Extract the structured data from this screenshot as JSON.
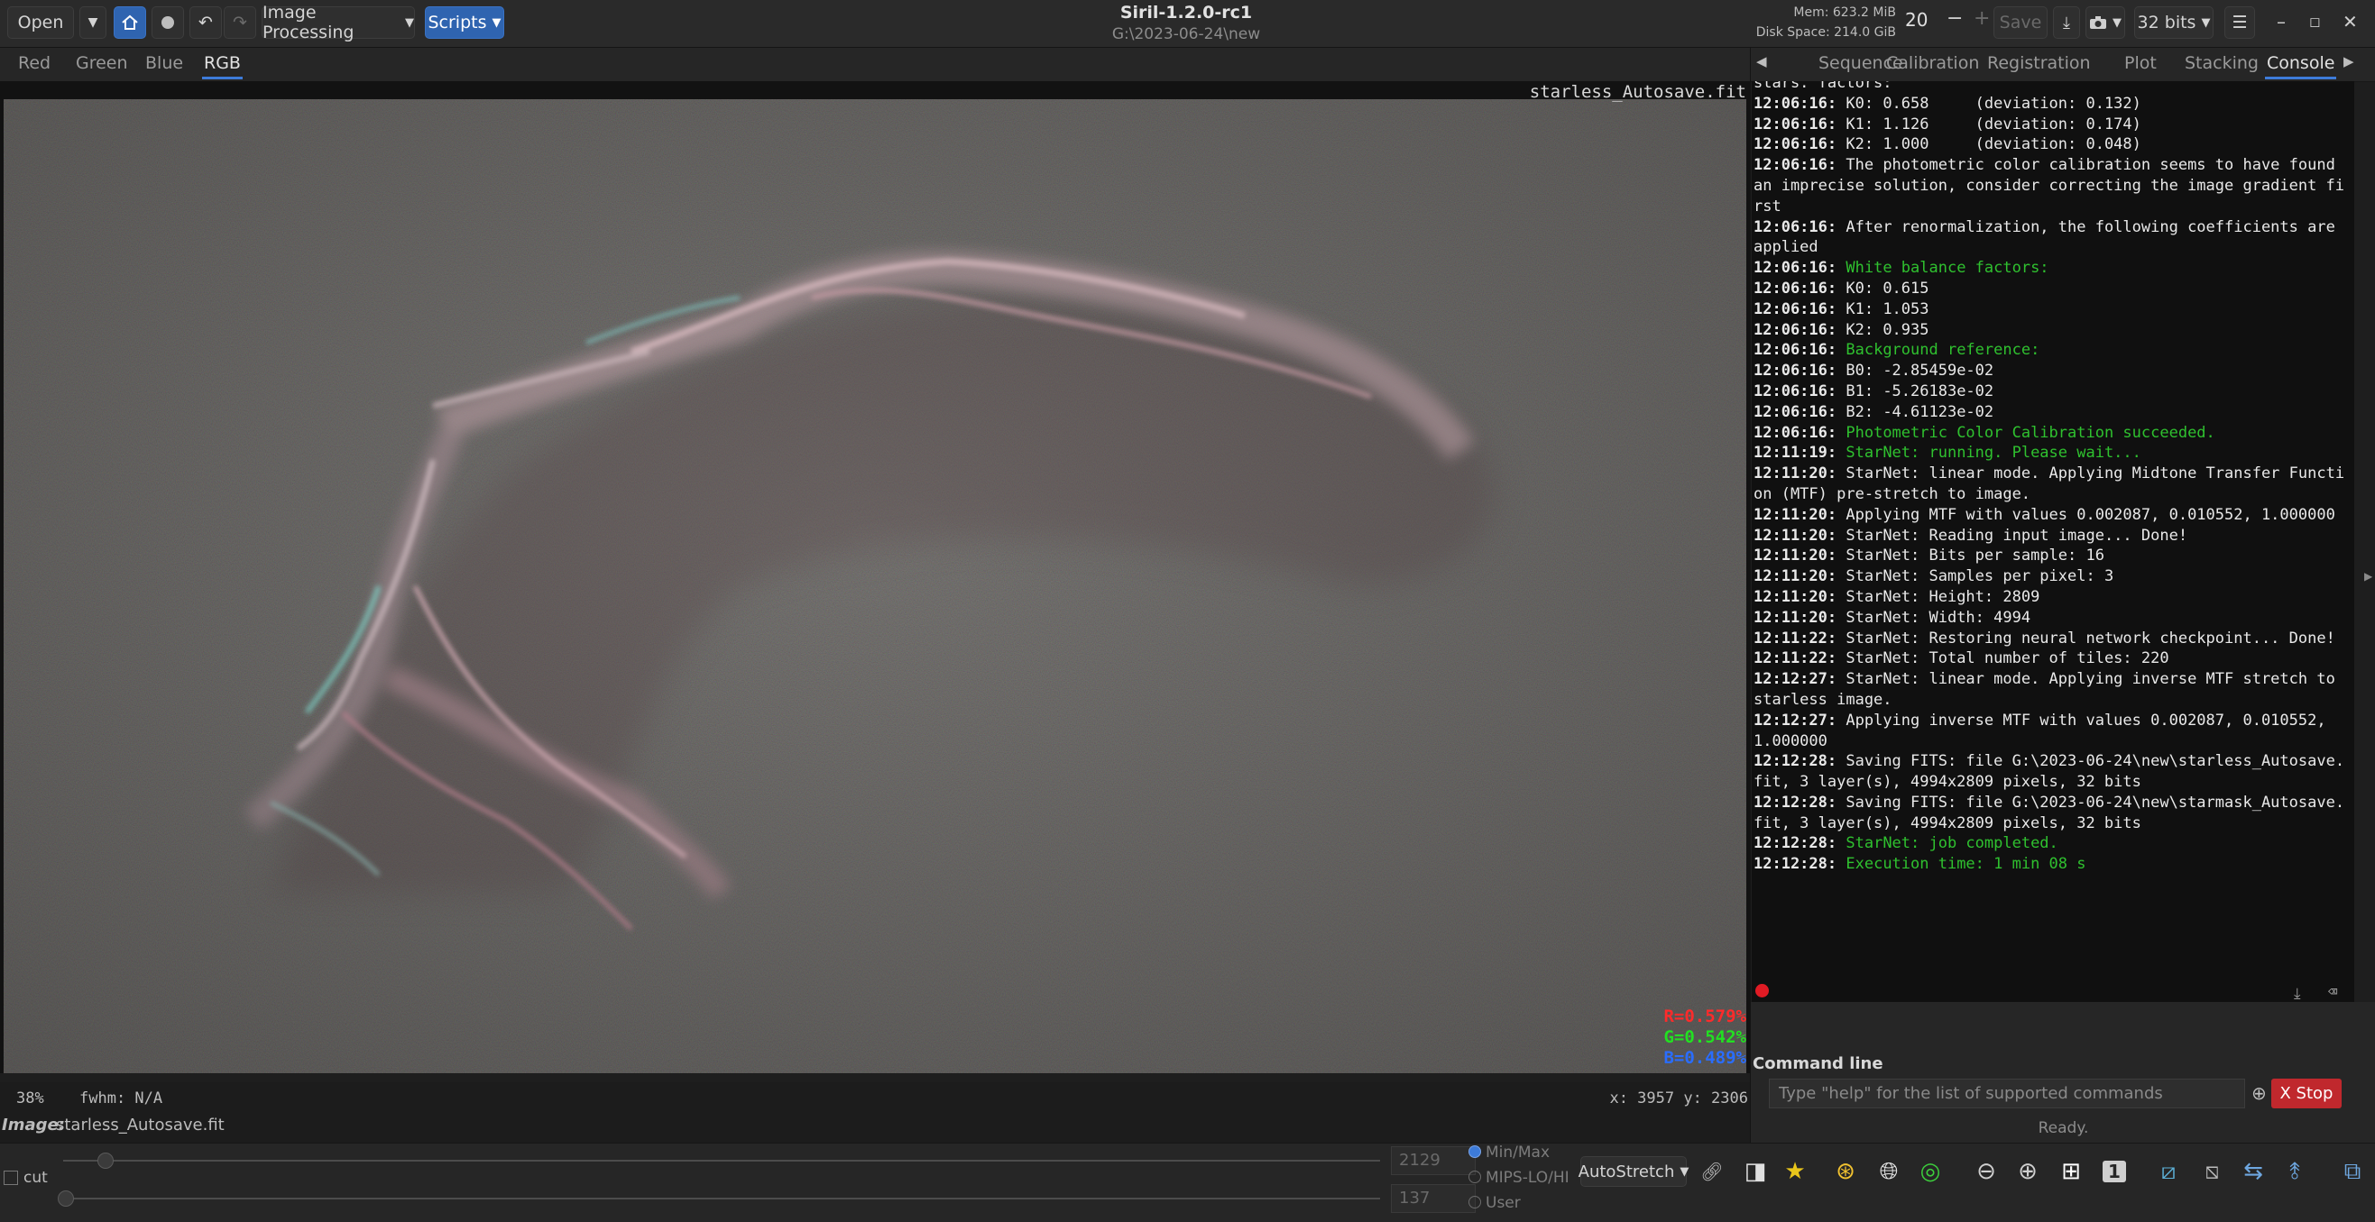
{
  "window": {
    "title": "Siril-1.2.0-rc1",
    "path": "G:\\2023-06-24\\new",
    "memory": "Mem: 623.2 MiB",
    "disk_space": "Disk Space: 214.0 GiB",
    "thread_count": "20"
  },
  "toolbar": {
    "open_label": "Open",
    "image_processing_label": "Image Processing",
    "scripts_label": "Scripts",
    "save_label": "Save",
    "bit_depth_label": "32 bits"
  },
  "channel_tabs": [
    "Red",
    "Green",
    "Blue",
    "RGB"
  ],
  "channel_tab_active": "RGB",
  "image_view": {
    "filename_overlay": "starless_Autosave.fit",
    "r_value": "R=0.579%",
    "g_value": "G=0.542%",
    "b_value": "B=0.489%",
    "zoom": "38%",
    "fwhm": "fwhm: N/A",
    "coords": "x: 3957 y: 2306",
    "image_label": "Image:",
    "image_name": "starless_Autosave.fit"
  },
  "panel_tabs": [
    "Sequence",
    "Calibration",
    "Registration",
    "Plot",
    "Stacking",
    "Console"
  ],
  "panel_tab_active": "Console",
  "console": [
    {
      "t": "",
      "m": "stars. factors:",
      "g": false
    },
    {
      "t": "12:06:16:",
      "m": "K0: 0.658     (deviation: 0.132)",
      "g": false
    },
    {
      "t": "12:06:16:",
      "m": "K1: 1.126     (deviation: 0.174)",
      "g": false
    },
    {
      "t": "12:06:16:",
      "m": "K2: 1.000     (deviation: 0.048)",
      "g": false
    },
    {
      "t": "12:06:16:",
      "m": "The photometric color calibration seems to have found an imprecise solution, consider correcting the image gradient first",
      "g": false
    },
    {
      "t": "12:06:16:",
      "m": "After renormalization, the following coefficients are applied",
      "g": false
    },
    {
      "t": "12:06:16:",
      "m": "White balance factors:",
      "g": true
    },
    {
      "t": "12:06:16:",
      "m": "K0: 0.615",
      "g": false
    },
    {
      "t": "12:06:16:",
      "m": "K1: 1.053",
      "g": false
    },
    {
      "t": "12:06:16:",
      "m": "K2: 0.935",
      "g": false
    },
    {
      "t": "12:06:16:",
      "m": "Background reference:",
      "g": true
    },
    {
      "t": "12:06:16:",
      "m": "B0: -2.85459e-02",
      "g": false
    },
    {
      "t": "12:06:16:",
      "m": "B1: -5.26183e-02",
      "g": false
    },
    {
      "t": "12:06:16:",
      "m": "B2: -4.61123e-02",
      "g": false
    },
    {
      "t": "12:06:16:",
      "m": "Photometric Color Calibration succeeded.",
      "g": true
    },
    {
      "t": "12:11:19:",
      "m": "StarNet: running. Please wait...",
      "g": true
    },
    {
      "t": "12:11:20:",
      "m": "StarNet: linear mode. Applying Midtone Transfer Function (MTF) pre-stretch to image.",
      "g": false
    },
    {
      "t": "12:11:20:",
      "m": "Applying MTF with values 0.002087, 0.010552, 1.000000",
      "g": false
    },
    {
      "t": "12:11:20:",
      "m": "StarNet: Reading input image... Done!",
      "g": false
    },
    {
      "t": "12:11:20:",
      "m": "StarNet: Bits per sample: 16",
      "g": false
    },
    {
      "t": "12:11:20:",
      "m": "StarNet: Samples per pixel: 3",
      "g": false
    },
    {
      "t": "12:11:20:",
      "m": "StarNet: Height: 2809",
      "g": false
    },
    {
      "t": "12:11:20:",
      "m": "StarNet: Width: 4994",
      "g": false
    },
    {
      "t": "12:11:22:",
      "m": "StarNet: Restoring neural network checkpoint... Done!",
      "g": false
    },
    {
      "t": "12:11:22:",
      "m": "StarNet: Total number of tiles: 220",
      "g": false
    },
    {
      "t": "12:12:27:",
      "m": "StarNet: linear mode. Applying inverse MTF stretch to starless image.",
      "g": false
    },
    {
      "t": "12:12:27:",
      "m": "Applying inverse MTF with values 0.002087, 0.010552, 1.000000",
      "g": false
    },
    {
      "t": "12:12:28:",
      "m": "Saving FITS: file G:\\2023-06-24\\new\\starless_Autosave.fit, 3 layer(s), 4994x2809 pixels, 32 bits",
      "g": false
    },
    {
      "t": "12:12:28:",
      "m": "Saving FITS: file G:\\2023-06-24\\new\\starmask_Autosave.fit, 3 layer(s), 4994x2809 pixels, 32 bits",
      "g": false
    },
    {
      "t": "12:12:28:",
      "m": "StarNet: job completed.",
      "g": true
    },
    {
      "t": "12:12:28:",
      "m": "Execution time: 1 min 08 s",
      "g": true
    }
  ],
  "command": {
    "label": "Command line",
    "placeholder": "Type \"help\" for the list of supported commands",
    "stop_label": "X Stop",
    "status": "Ready."
  },
  "bottom": {
    "cut_label": "cut",
    "max_value": "2129",
    "min_value": "137",
    "radio_minmax": "Min/Max",
    "radio_mips": "MIPS-LO/HI",
    "radio_user": "User",
    "stretch_label": "AutoStretch",
    "zoom_one_label": "1"
  },
  "colors": {
    "accent": "#3d7bd9",
    "stop": "#c0282d",
    "console_green": "#2fc12f",
    "r_value": "#ff2b2b",
    "g_value": "#22e022",
    "b_value": "#2a6dff"
  }
}
